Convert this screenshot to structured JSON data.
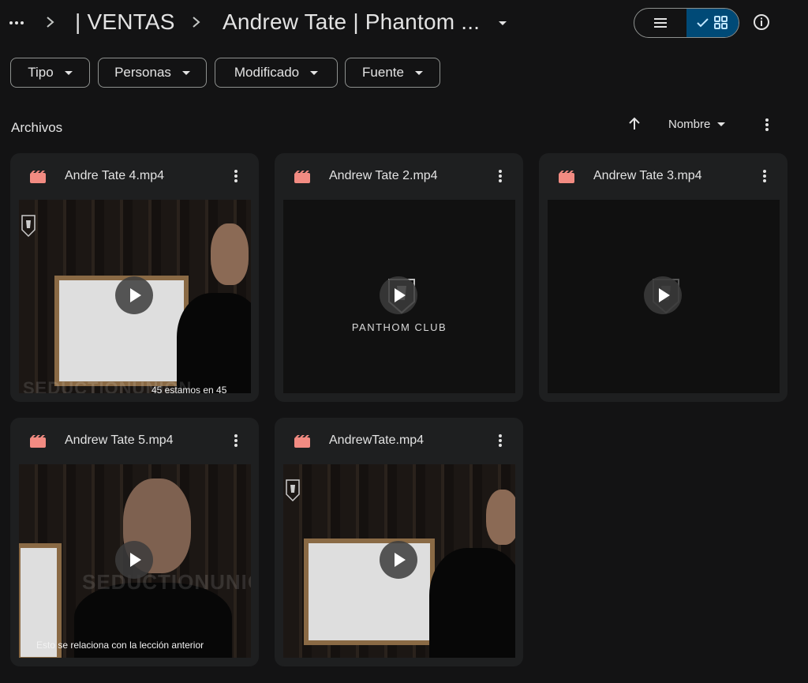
{
  "breadcrumb": {
    "more_label": "•••",
    "items": [
      "| VENTAS",
      "Andrew Tate | Phantom ..."
    ]
  },
  "view_toggle": {
    "list_icon": "list-icon",
    "grid_icon": "grid-icon",
    "active": "grid"
  },
  "filters": [
    {
      "label": "Tipo"
    },
    {
      "label": "Personas"
    },
    {
      "label": "Modificado"
    },
    {
      "label": "Fuente"
    }
  ],
  "section": {
    "title": "Archivos",
    "sort_label": "Nombre",
    "sort_direction": "ascending"
  },
  "files": [
    {
      "name": "Andre Tate 4.mp4",
      "thumb_caption": "45 estamos en 45",
      "watermark": "SEDUCTIONUNION"
    },
    {
      "name": "Andrew Tate 2.mp4",
      "thumb_caption": "PANTHOM CLUB"
    },
    {
      "name": "Andrew Tate 3.mp4"
    },
    {
      "name": "Andrew Tate 5.mp4",
      "thumb_caption": "Esto se relaciona con la lección anterior",
      "watermark": "SEDUCTIONUNION"
    },
    {
      "name": "AndrewTate.mp4"
    }
  ],
  "colors": {
    "background": "#131314",
    "card": "#1e1f20",
    "video_icon": "#f28b82",
    "active_toggle": "#004a77",
    "text": "#e3e3e3"
  }
}
